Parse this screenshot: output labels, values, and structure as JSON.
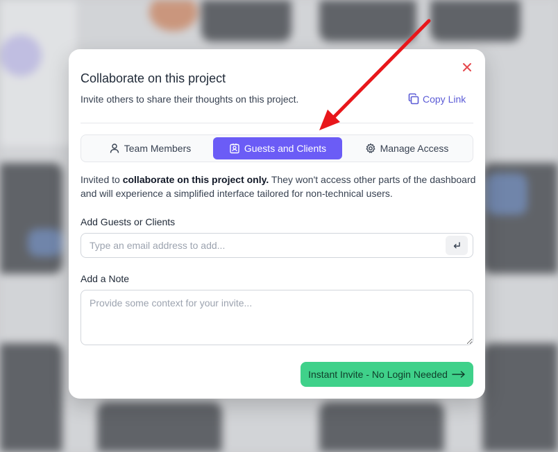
{
  "modal": {
    "title": "Collaborate on this project",
    "subtitle": "Invite others to share their thoughts on this project.",
    "copy_link_label": "Copy Link",
    "close_icon": "close-icon"
  },
  "tabs": [
    {
      "label": "Team Members",
      "icon": "user-icon",
      "active": false
    },
    {
      "label": "Guests and Clients",
      "icon": "contact-badge-icon",
      "active": true
    },
    {
      "label": "Manage Access",
      "icon": "gear-icon",
      "active": false
    }
  ],
  "description": {
    "prefix": "Invited to ",
    "bold": "collaborate on this project only.",
    "suffix": " They won't access other parts of the dashboard and will experience a simplified interface tailored for non-technical users."
  },
  "guests": {
    "label": "Add Guests or Clients",
    "placeholder": "Type an email address to add...",
    "value": "",
    "enter_icon": "enter-key-icon"
  },
  "note": {
    "label": "Add a Note",
    "placeholder": "Provide some context for your invite...",
    "value": ""
  },
  "invite_button": {
    "label": "Instant Invite - No Login Needed",
    "icon": "arrow-right-icon"
  },
  "colors": {
    "accent": "#6b5cf6",
    "link": "#5b5bd6",
    "invite_green": "#3fd18a",
    "close_red": "#e5484d",
    "annotation_red": "#e8171b"
  }
}
